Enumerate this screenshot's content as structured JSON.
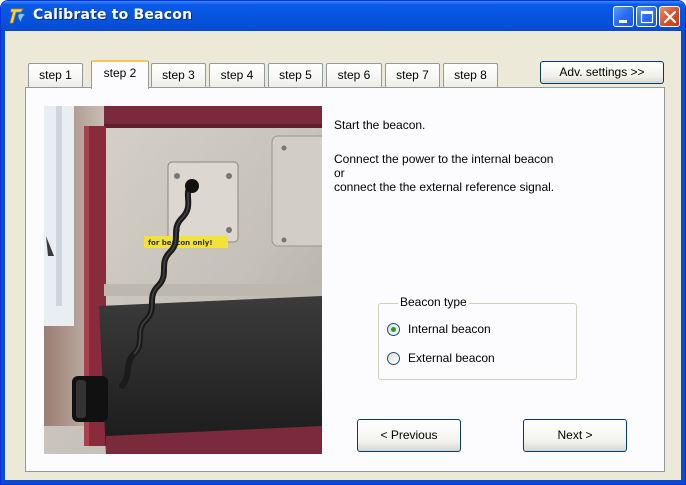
{
  "window": {
    "title": "Calibrate to Beacon",
    "accent": "#0a5ae8"
  },
  "tabs": [
    {
      "label": "step 1",
      "active": false
    },
    {
      "label": "step 2",
      "active": true
    },
    {
      "label": "step 3",
      "active": false
    },
    {
      "label": "step 4",
      "active": false
    },
    {
      "label": "step 5",
      "active": false
    },
    {
      "label": "step 6",
      "active": false
    },
    {
      "label": "step 7",
      "active": false
    },
    {
      "label": "step 8",
      "active": false
    }
  ],
  "adv_settings_label": "Adv. settings >>",
  "photo": {
    "sticker_text": "for beacon only!"
  },
  "instructions": {
    "line1": "Start the beacon.",
    "line2": "Connect the power to the internal beacon",
    "line3": "or",
    "line4": "connect the the external reference signal."
  },
  "beacon_type": {
    "legend": "Beacon type",
    "options": [
      {
        "label": "Internal beacon",
        "checked": true
      },
      {
        "label": "External beacon",
        "checked": false
      }
    ]
  },
  "buttons": {
    "previous": "< Previous",
    "next": "Next >"
  },
  "icons": [
    "app-icon",
    "minimize-icon",
    "maximize-icon",
    "close-icon"
  ]
}
